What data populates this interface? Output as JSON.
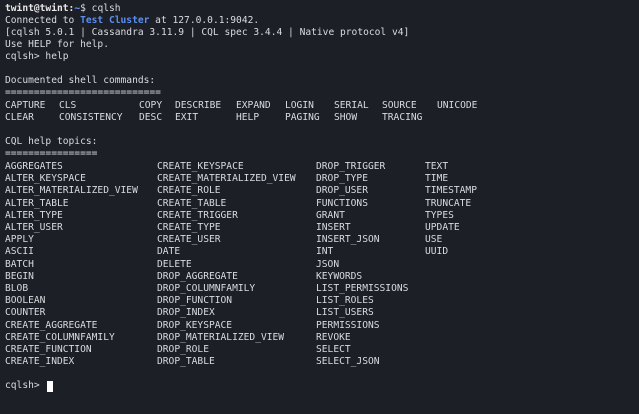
{
  "prompt": {
    "user_host": "twint@twint",
    "sep": ":",
    "path": "~",
    "dollar": "$ ",
    "command": "cqlsh"
  },
  "connect": {
    "prefix": "Connected to ",
    "cluster": "Test Cluster",
    "suffix": " at 127.0.0.1:9042."
  },
  "version_line": "[cqlsh 5.0.1 | Cassandra 3.11.9 | CQL spec 3.4.4 | Native protocol v4]",
  "help_hint": "Use HELP for help.",
  "help_cmd": "cqlsh> help",
  "documented": {
    "title": "Documented shell commands:",
    "underline": "===========================",
    "row1": [
      "CAPTURE",
      "CLS",
      "COPY",
      "DESCRIBE",
      "EXPAND",
      "LOGIN",
      "SERIAL",
      "SOURCE",
      "UNICODE"
    ],
    "row2": [
      "CLEAR",
      "CONSISTENCY",
      "DESC",
      "EXIT",
      "HELP",
      "PAGING",
      "SHOW",
      "TRACING"
    ]
  },
  "cql_topics": {
    "title": "CQL help topics:",
    "underline": "================",
    "col1": [
      "AGGREGATES",
      "ALTER_KEYSPACE",
      "ALTER_MATERIALIZED_VIEW",
      "ALTER_TABLE",
      "ALTER_TYPE",
      "ALTER_USER",
      "APPLY",
      "ASCII",
      "BATCH",
      "BEGIN",
      "BLOB",
      "BOOLEAN",
      "COUNTER",
      "CREATE_AGGREGATE",
      "CREATE_COLUMNFAMILY",
      "CREATE_FUNCTION",
      "CREATE_INDEX"
    ],
    "col2": [
      "CREATE_KEYSPACE",
      "CREATE_MATERIALIZED_VIEW",
      "CREATE_ROLE",
      "CREATE_TABLE",
      "CREATE_TRIGGER",
      "CREATE_TYPE",
      "CREATE_USER",
      "DATE",
      "DELETE",
      "DROP_AGGREGATE",
      "DROP_COLUMNFAMILY",
      "DROP_FUNCTION",
      "DROP_INDEX",
      "DROP_KEYSPACE",
      "DROP_MATERIALIZED_VIEW",
      "DROP_ROLE",
      "DROP_TABLE"
    ],
    "col3": [
      "DROP_TRIGGER",
      "DROP_TYPE",
      "DROP_USER",
      "FUNCTIONS",
      "GRANT",
      "INSERT",
      "INSERT_JSON",
      "INT",
      "JSON",
      "KEYWORDS",
      "LIST_PERMISSIONS",
      "LIST_ROLES",
      "LIST_USERS",
      "PERMISSIONS",
      "REVOKE",
      "SELECT",
      "SELECT_JSON"
    ],
    "col4": [
      "TEXT",
      "TIME",
      "TIMESTAMP",
      "TRUNCATE",
      "TYPES",
      "UPDATE",
      "USE",
      "UUID"
    ]
  },
  "final_prompt": "cqlsh> "
}
